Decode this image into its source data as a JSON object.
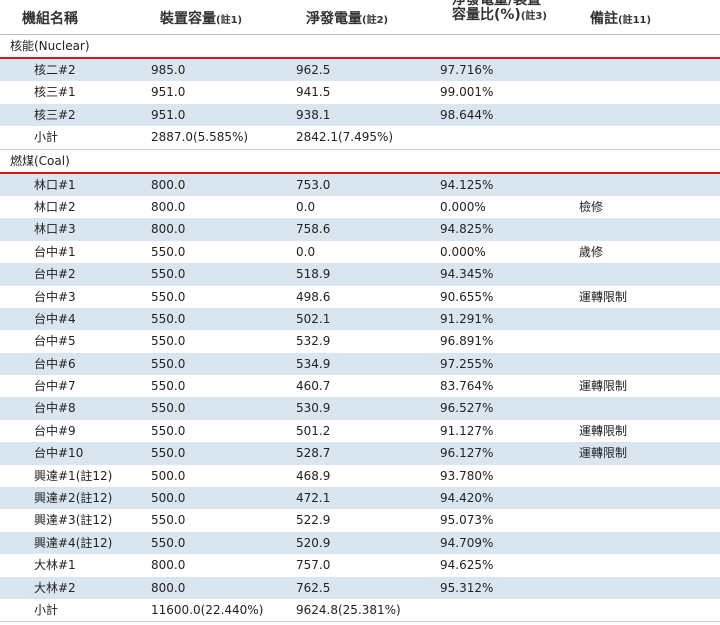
{
  "header": {
    "col_name": "機組名稱",
    "col_capacity": "裝置容量",
    "col_capacity_note": "(註1)",
    "col_net": "淨發電量",
    "col_net_note": "(註2)",
    "col_ratio_line1": "淨發電量/裝置",
    "col_ratio_line2": "容量比(%)",
    "col_ratio_note": "(註3)",
    "col_remark": "備註",
    "col_remark_note": "(註11)"
  },
  "nuclear": {
    "title": "核能(Nuclear)",
    "rows": [
      {
        "name": "核二#2",
        "capacity": "985.0",
        "net": "962.5",
        "ratio": "97.716%",
        "note": ""
      },
      {
        "name": "核三#1",
        "capacity": "951.0",
        "net": "941.5",
        "ratio": "99.001%",
        "note": ""
      },
      {
        "name": "核三#2",
        "capacity": "951.0",
        "net": "938.1",
        "ratio": "98.644%",
        "note": ""
      }
    ],
    "subtotal": {
      "name": "小計",
      "capacity": "2887.0(5.585%)",
      "net": "2842.1(7.495%)"
    }
  },
  "coal": {
    "title": "燃煤(Coal)",
    "rows": [
      {
        "name": "林口#1",
        "capacity": "800.0",
        "net": "753.0",
        "ratio": "94.125%",
        "note": ""
      },
      {
        "name": "林口#2",
        "capacity": "800.0",
        "net": "0.0",
        "ratio": "0.000%",
        "note": "檢修"
      },
      {
        "name": "林口#3",
        "capacity": "800.0",
        "net": "758.6",
        "ratio": "94.825%",
        "note": ""
      },
      {
        "name": "台中#1",
        "capacity": "550.0",
        "net": "0.0",
        "ratio": "0.000%",
        "note": "歲修"
      },
      {
        "name": "台中#2",
        "capacity": "550.0",
        "net": "518.9",
        "ratio": "94.345%",
        "note": ""
      },
      {
        "name": "台中#3",
        "capacity": "550.0",
        "net": "498.6",
        "ratio": "90.655%",
        "note": "運轉限制"
      },
      {
        "name": "台中#4",
        "capacity": "550.0",
        "net": "502.1",
        "ratio": "91.291%",
        "note": ""
      },
      {
        "name": "台中#5",
        "capacity": "550.0",
        "net": "532.9",
        "ratio": "96.891%",
        "note": ""
      },
      {
        "name": "台中#6",
        "capacity": "550.0",
        "net": "534.9",
        "ratio": "97.255%",
        "note": ""
      },
      {
        "name": "台中#7",
        "capacity": "550.0",
        "net": "460.7",
        "ratio": "83.764%",
        "note": "運轉限制"
      },
      {
        "name": "台中#8",
        "capacity": "550.0",
        "net": "530.9",
        "ratio": "96.527%",
        "note": ""
      },
      {
        "name": "台中#9",
        "capacity": "550.0",
        "net": "501.2",
        "ratio": "91.127%",
        "note": "運轉限制"
      },
      {
        "name": "台中#10",
        "capacity": "550.0",
        "net": "528.7",
        "ratio": "96.127%",
        "note": "運轉限制"
      },
      {
        "name": "興達#1(註12)",
        "capacity": "500.0",
        "net": "468.9",
        "ratio": "93.780%",
        "note": ""
      },
      {
        "name": "興達#2(註12)",
        "capacity": "500.0",
        "net": "472.1",
        "ratio": "94.420%",
        "note": ""
      },
      {
        "name": "興達#3(註12)",
        "capacity": "550.0",
        "net": "522.9",
        "ratio": "95.073%",
        "note": ""
      },
      {
        "name": "興達#4(註12)",
        "capacity": "550.0",
        "net": "520.9",
        "ratio": "94.709%",
        "note": ""
      },
      {
        "name": "大林#1",
        "capacity": "800.0",
        "net": "757.0",
        "ratio": "94.625%",
        "note": ""
      },
      {
        "name": "大林#2",
        "capacity": "800.0",
        "net": "762.5",
        "ratio": "95.312%",
        "note": ""
      }
    ],
    "subtotal": {
      "name": "小計",
      "capacity": "11600.0(22.440%)",
      "net": "9624.8(25.381%)"
    }
  }
}
